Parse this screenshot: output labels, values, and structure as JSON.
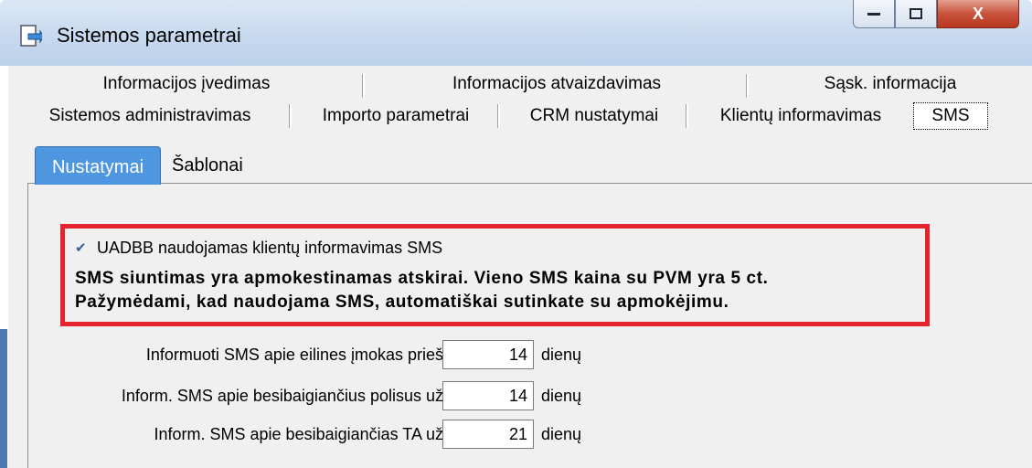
{
  "window": {
    "title": "Sistemos parametrai",
    "close_symbol": "X"
  },
  "tabs_row1": [
    {
      "label": "Informacijos įvedimas"
    },
    {
      "label": "Informacijos atvaizdavimas"
    },
    {
      "label": "Sąsk. informacija"
    }
  ],
  "tabs_row2": [
    {
      "label": "Sistemos administravimas"
    },
    {
      "label": "Importo parametrai"
    },
    {
      "label": "CRM nustatymai"
    },
    {
      "label": "Klientų informavimas"
    },
    {
      "label": "SMS",
      "selected": true
    }
  ],
  "subtabs": [
    {
      "label": "Nustatymai",
      "active": true
    },
    {
      "label": "Šablonai"
    }
  ],
  "sms_option": {
    "checkbox_label": "UADBB naudojamas klientų informavimas SMS",
    "checked": true,
    "warning_line1": "SMS siuntimas yra apmokestinamas atskirai. Vieno SMS kaina su PVM yra 5 ct.",
    "warning_line2": "Pažymėdami, kad naudojama SMS, automatiškai sutinkate su apmokėjimu."
  },
  "fields": [
    {
      "label": "Informuoti SMS apie eilines įmokas prieš",
      "value": "14",
      "unit": "dienų"
    },
    {
      "label": "Inform. SMS apie besibaigiančius polisus už",
      "value": "14",
      "unit": "dienų"
    },
    {
      "label": "Inform. SMS apie besibaigiančias TA už",
      "value": "21",
      "unit": "dienų"
    }
  ],
  "colors": {
    "highlight_border": "#e4232e",
    "active_subtab": "#4e96e0",
    "close_button": "#c8523c"
  }
}
